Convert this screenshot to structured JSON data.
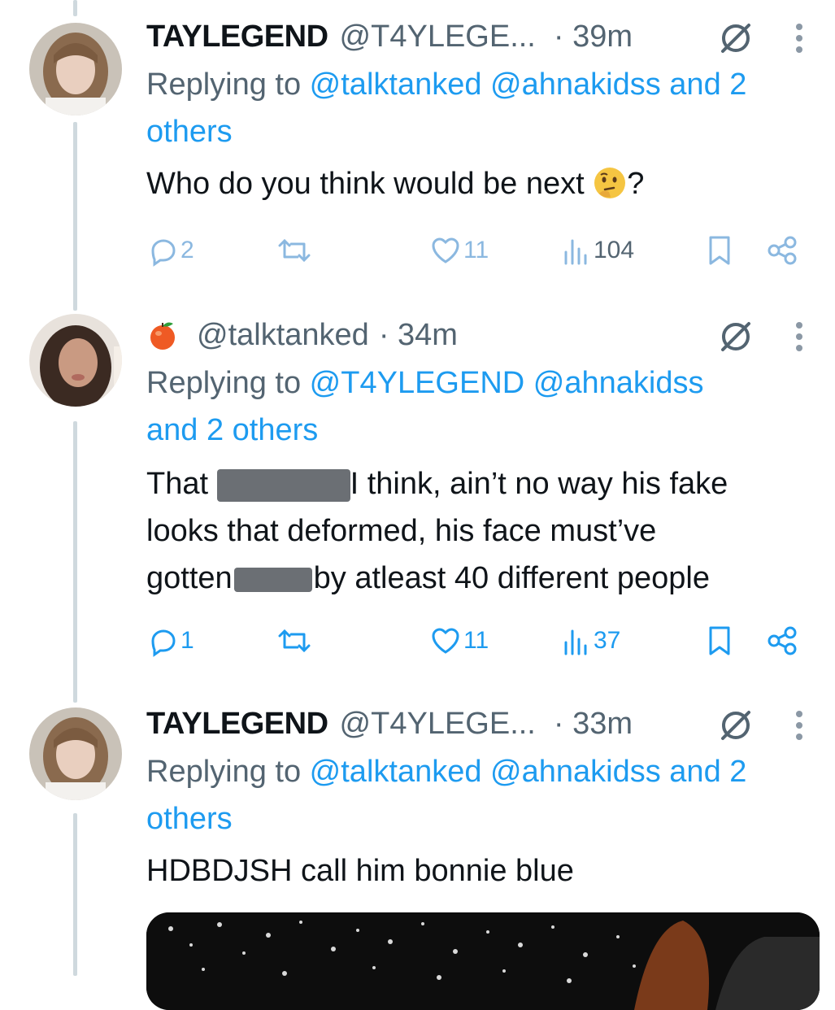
{
  "tweets": [
    {
      "display_name": "TAYLEGEND",
      "handle": "@T4YLEGE...",
      "time": "· 39m",
      "replying_prefix": "Replying to ",
      "replying_links": [
        "@talktanked",
        "@ahnakidss",
        "and 2 others"
      ],
      "text": "Who do you think would be next",
      "text_suffix": "?",
      "emoji": "thinking-face",
      "stats": {
        "replies": "2",
        "retweets": "",
        "likes": "11",
        "views": "104"
      }
    },
    {
      "display_name": "",
      "handle": "@talktanked",
      "time": "· 34m",
      "replying_prefix": "Replying to ",
      "replying_links": [
        "@T4YLEGEND",
        "@ahnakidss",
        "and 2 others"
      ],
      "text_line1_a": "That",
      "text_line1_b": "I think, ain’t no way his fake",
      "text_line2": "looks that deformed, his face must’ve",
      "text_line3_a": "gotten",
      "text_line3_b": "by atleast 40 different people",
      "stats": {
        "replies": "1",
        "retweets": "",
        "likes": "11",
        "views": "37"
      }
    },
    {
      "display_name": "TAYLEGEND",
      "handle": "@T4YLEGE...",
      "time": "· 33m",
      "replying_prefix": "Replying to ",
      "replying_links": [
        "@talktanked",
        "@ahnakidss",
        "and 2 others"
      ],
      "text": "HDBDJSH call him bonnie blue"
    }
  ],
  "icons": [
    "reply-icon",
    "retweet-icon",
    "like-icon",
    "views-icon",
    "bookmark-icon",
    "share-icon",
    "grok-icon",
    "more-icon"
  ],
  "colors": {
    "link": "#1d9bf0",
    "muted": "#536471",
    "text": "#0f1419",
    "thread_line": "#cfd9de"
  }
}
